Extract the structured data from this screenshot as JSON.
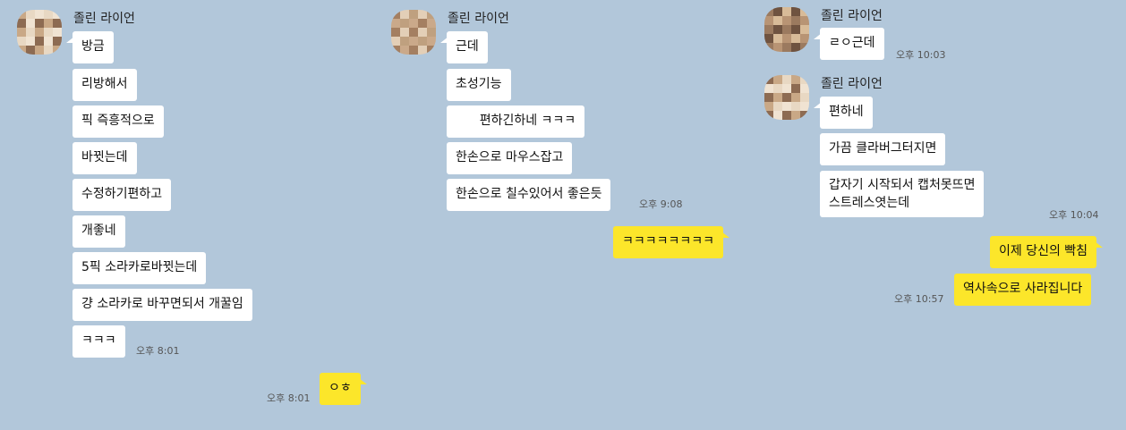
{
  "colors": {
    "background": "#b2c7da",
    "incoming": "#ffffff",
    "outgoing": "#fce62a"
  },
  "panels": [
    {
      "sender": "졸린 라이언",
      "messages": [
        "방금",
        "리방해서",
        "픽 즉흥적으로",
        "바뀟는데",
        "수정하기편하고",
        "개좋네",
        "5픽 소라카로바뀟는데",
        "걍 소라카로 바꾸면되서 개꿀임",
        "ㅋㅋㅋ"
      ],
      "time": "오후 8:01",
      "mine": {
        "text": "ㅇㅎ",
        "time": "오후 8:01"
      }
    },
    {
      "sender": "졸린 라이언",
      "messages": [
        "근데",
        "초성기능",
        "      편하긴하네 ㅋㅋㅋ",
        "한손으로 마우스잡고",
        "한손으로 칠수있어서 좋은듯"
      ],
      "time": "오후 9:08",
      "mine": {
        "text": "ㅋㅋㅋㅋㅋㅋㅋㅋ"
      }
    },
    {
      "groups": [
        {
          "sender": "졸린 라이언",
          "messages": [
            "ㄹㅇ근데"
          ],
          "time": "오후 10:03"
        },
        {
          "sender": "졸린 라이언",
          "messages": [
            "편하네",
            "가끔 클라버그터지면",
            "갑자기 시작되서 캡처못뜨면\n스트레스엿는데"
          ],
          "time": "오후 10:04"
        }
      ],
      "mine": [
        {
          "text": "이제 당신의 빡침"
        },
        {
          "text": "역사속으로 사라집니다",
          "time": "오후 10:57"
        }
      ]
    }
  ]
}
